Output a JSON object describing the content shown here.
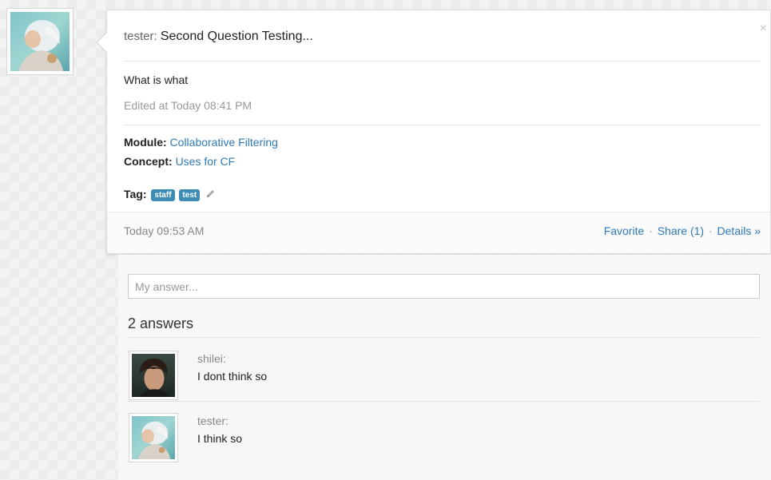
{
  "question": {
    "author": "tester",
    "title": "Second Question Testing...",
    "close_label": "×",
    "body": "What is what",
    "edited": "Edited at Today 08:41 PM",
    "module_label": "Module:",
    "module_value": "Collaborative Filtering",
    "concept_label": "Concept:",
    "concept_value": "Uses for CF",
    "tag_label": "Tag:",
    "tags": [
      "staff",
      "test"
    ],
    "timestamp": "Today 09:53 AM",
    "actions": {
      "favorite": "Favorite",
      "share": "Share (1)",
      "details": "Details »",
      "separator": "·"
    }
  },
  "answer_box": {
    "placeholder": "My answer..."
  },
  "answers": {
    "count_label": "2 answers",
    "items": [
      {
        "author": "shilei",
        "text": "I dont think so"
      },
      {
        "author": "tester",
        "text": "I think so"
      }
    ]
  },
  "colors": {
    "link": "#2f7ab9",
    "tag_bg": "#3e8cb6"
  }
}
